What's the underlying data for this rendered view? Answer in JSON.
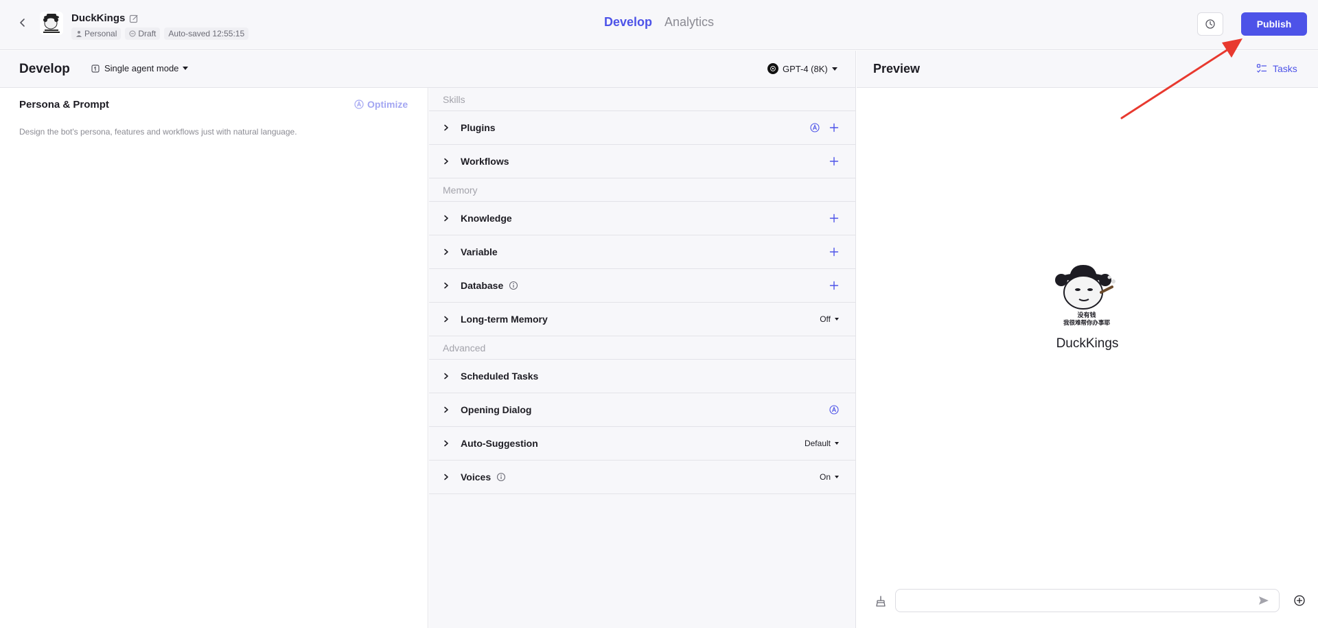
{
  "colors": {
    "accent": "#4d53e8",
    "annotation": "#e8392f"
  },
  "header": {
    "bot_name": "DuckKings",
    "meta": {
      "space": "Personal",
      "status": "Draft",
      "autosave": "Auto-saved 12:55:15"
    },
    "tabs": {
      "develop": "Develop",
      "analytics": "Analytics"
    },
    "publish_label": "Publish"
  },
  "develop": {
    "title": "Develop",
    "mode_label": "Single agent mode",
    "model_label": "GPT-4 (8K)"
  },
  "persona": {
    "title": "Persona & Prompt",
    "optimize_label": "Optimize",
    "hint": "Design the bot's persona, features and workflows just with natural language."
  },
  "skills": {
    "sections": {
      "skills": "Skills",
      "memory": "Memory",
      "advanced": "Advanced"
    },
    "rows": {
      "plugins": "Plugins",
      "workflows": "Workflows",
      "knowledge": "Knowledge",
      "variable": "Variable",
      "database": "Database",
      "long_term_memory": "Long-term Memory",
      "long_term_memory_value": "Off",
      "scheduled_tasks": "Scheduled Tasks",
      "opening_dialog": "Opening Dialog",
      "auto_suggestion": "Auto-Suggestion",
      "auto_suggestion_value": "Default",
      "voices": "Voices",
      "voices_value": "On"
    }
  },
  "preview": {
    "title": "Preview",
    "tasks_label": "Tasks",
    "bot_name": "DuckKings",
    "avatar_caption_line1": "没有钱",
    "avatar_caption_line2": "我很难帮你办事耶",
    "input_placeholder": ""
  }
}
